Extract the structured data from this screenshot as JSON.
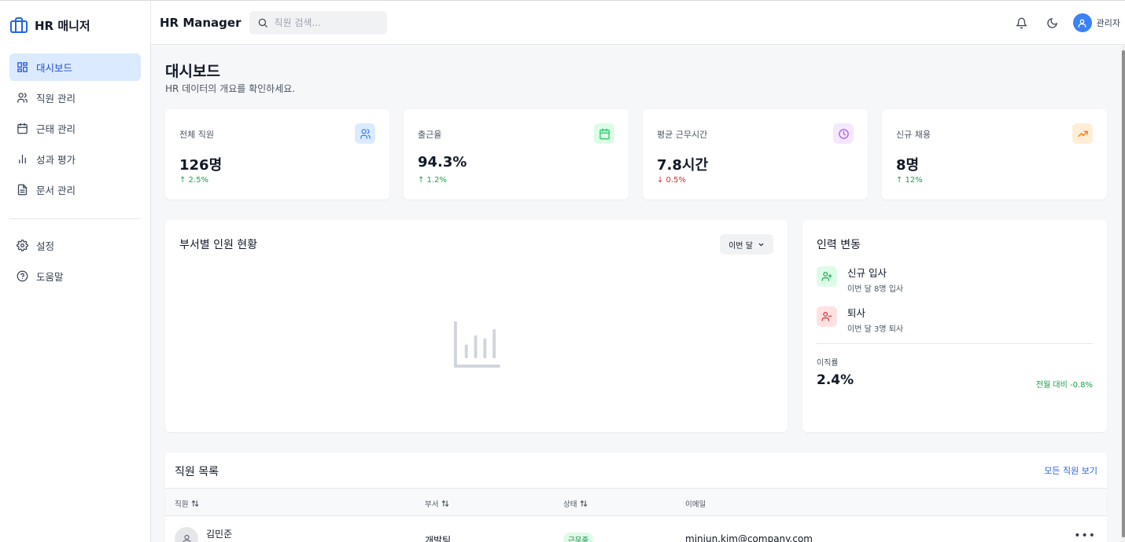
{
  "sidebar": {
    "brand": "HR 매니저",
    "items": [
      {
        "label": "대시보드",
        "icon": "dashboard-icon",
        "active": true
      },
      {
        "label": "직원 관리",
        "icon": "users-icon"
      },
      {
        "label": "근태 관리",
        "icon": "calendar-icon"
      },
      {
        "label": "성과 평가",
        "icon": "bar-chart-icon"
      },
      {
        "label": "문서 관리",
        "icon": "document-icon"
      }
    ],
    "bottom_items": [
      {
        "label": "설정",
        "icon": "gear-icon"
      },
      {
        "label": "도움말",
        "icon": "help-icon"
      }
    ]
  },
  "header": {
    "title": "HR Manager",
    "search_placeholder": "직원 검색...",
    "user_name": "관리자"
  },
  "page": {
    "title": "대시보드",
    "subtitle": "HR 데이터의 개요를 확인하세요."
  },
  "stats": [
    {
      "label": "전체 직원",
      "value": "126명",
      "change": "↑ 2.5%",
      "trend": "up",
      "icon": "users-icon",
      "color": "#3b82f6"
    },
    {
      "label": "출근율",
      "value": "94.3%",
      "change": "↑ 1.2%",
      "trend": "up",
      "icon": "calendar-icon",
      "color": "#22c55e"
    },
    {
      "label": "평균 근무시간",
      "value": "7.8시간",
      "change": "↓ 0.5%",
      "trend": "down",
      "icon": "clock-icon",
      "color": "#a855f7"
    },
    {
      "label": "신규 채용",
      "value": "8명",
      "change": "↑ 12%",
      "trend": "up",
      "icon": "trending-up-icon",
      "color": "#f97316"
    }
  ],
  "dept_chart": {
    "title": "부서별 인원 현황",
    "period_selected": "이번 달"
  },
  "workforce": {
    "title": "인력 변동",
    "items": [
      {
        "title": "신규 입사",
        "desc": "이번 달 8명 입사",
        "icon": "user-plus-icon"
      },
      {
        "title": "퇴사",
        "desc": "이번 달 3명 퇴사",
        "icon": "user-minus-icon"
      }
    ],
    "turnover_label": "이직률",
    "turnover_value": "2.4%",
    "turnover_compare": "전월 대비 -0.8%"
  },
  "employees": {
    "title": "직원 목록",
    "view_all": "모든 직원 보기",
    "columns": [
      "직원",
      "부서",
      "상태",
      "이메일"
    ],
    "rows": [
      {
        "name": "김민준",
        "dept": "개발팀",
        "status": "근무중",
        "email": "minjun.kim@company.com"
      }
    ]
  }
}
